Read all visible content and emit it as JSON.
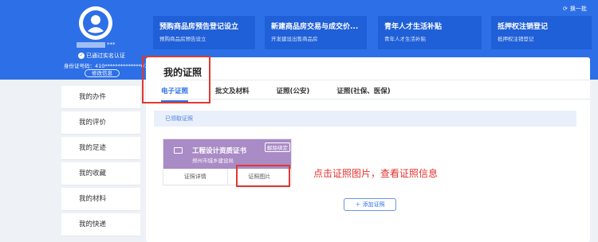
{
  "profile": {
    "username_suffix": "***",
    "verified_text": "已通过实名认证",
    "id_number": "身份证号码：410**************07",
    "edit_label": "修改信息"
  },
  "header": {
    "switch_label": "换一批"
  },
  "services": [
    {
      "title": "预购商品房预告登记设立",
      "subtitle": "预购商品房预告设立"
    },
    {
      "title": "新建商品房交易与成交价...",
      "subtitle": "开发建设出售商品房"
    },
    {
      "title": "青年人才生活补贴",
      "subtitle": "青年人才生活补贴"
    },
    {
      "title": "抵押权注销登记",
      "subtitle": "抵押权注销登记"
    }
  ],
  "sidebar": {
    "items": [
      {
        "label": "我的办件"
      },
      {
        "label": "我的评价"
      },
      {
        "label": "我的足迹"
      },
      {
        "label": "我的收藏"
      },
      {
        "label": "我的材料"
      },
      {
        "label": "我的快递"
      }
    ]
  },
  "main": {
    "title": "我的证照",
    "tabs": [
      {
        "label": "电子证照",
        "active": true
      },
      {
        "label": "批文及材料",
        "active": false
      },
      {
        "label": "证照(公安)",
        "active": false
      },
      {
        "label": "证照(社保、医保)",
        "active": false
      }
    ],
    "received_label": "已领取证照",
    "certificate": {
      "name": "工程设计资质证书",
      "issuer": "郑州市城乡建设局",
      "unbind_label": "解除绑定",
      "details_label": "证照详情",
      "image_label": "证照图片"
    },
    "add_label": "添加证照"
  },
  "annotation": {
    "instruction": "点击证照图片，查看证照信息"
  },
  "colors": {
    "brand": "#2d6fe6",
    "card": "#a98bc6",
    "highlight": "#e0392f"
  }
}
